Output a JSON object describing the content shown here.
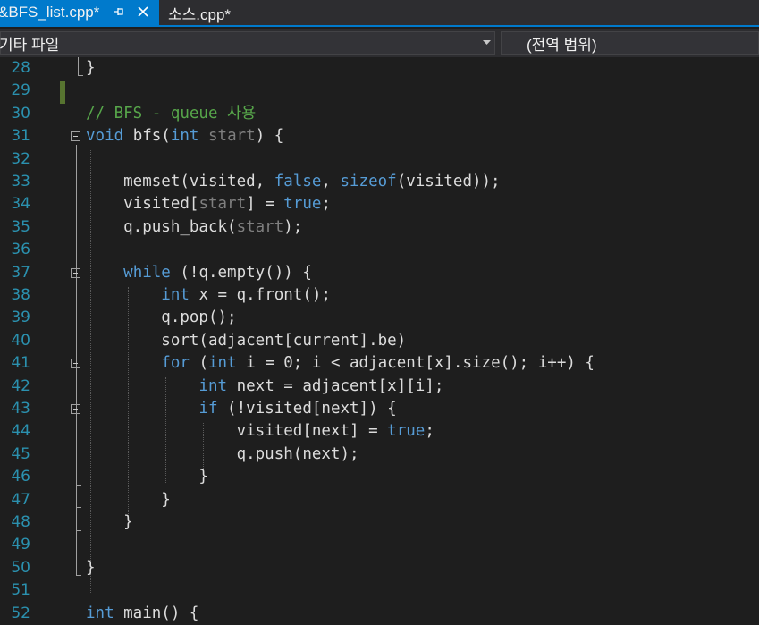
{
  "tabs": [
    {
      "label": "&BFS_list.cpp*",
      "active": true
    },
    {
      "label": "소스.cpp*",
      "active": false
    }
  ],
  "nav": {
    "scope_label": "기타 파일",
    "member_label": "(전역 범위)"
  },
  "colors": {
    "accent": "#007acc",
    "keyword": "#569cd6",
    "comment": "#57a64a",
    "line_number": "#2b91af",
    "text": "#dcdcdc",
    "change_marker": "#577430"
  },
  "lines": [
    {
      "n": "28",
      "tokens": [
        [
          "t",
          "}"
        ]
      ]
    },
    {
      "n": "29",
      "tokens": []
    },
    {
      "n": "30",
      "tokens": [
        [
          "cm",
          "// BFS - queue 사용"
        ]
      ]
    },
    {
      "n": "31",
      "tokens": [
        [
          "kw",
          "void"
        ],
        [
          "t",
          " bfs("
        ],
        [
          "kw",
          "int"
        ],
        [
          "t",
          " "
        ],
        [
          "pm",
          "start"
        ],
        [
          "t",
          ") {"
        ]
      ]
    },
    {
      "n": "32",
      "tokens": []
    },
    {
      "n": "33",
      "tokens": [
        [
          "t",
          "    memset(visited, "
        ],
        [
          "kw",
          "false"
        ],
        [
          "t",
          ", "
        ],
        [
          "kw",
          "sizeof"
        ],
        [
          "t",
          "(visited));"
        ]
      ]
    },
    {
      "n": "34",
      "tokens": [
        [
          "t",
          "    visited["
        ],
        [
          "pm",
          "start"
        ],
        [
          "t",
          "] = "
        ],
        [
          "kw",
          "true"
        ],
        [
          "t",
          ";"
        ]
      ]
    },
    {
      "n": "35",
      "tokens": [
        [
          "t",
          "    q.push_back("
        ],
        [
          "pm",
          "start"
        ],
        [
          "t",
          ");"
        ]
      ]
    },
    {
      "n": "36",
      "tokens": []
    },
    {
      "n": "37",
      "tokens": [
        [
          "t",
          "    "
        ],
        [
          "kw",
          "while"
        ],
        [
          "t",
          " (!q.empty()) {"
        ]
      ]
    },
    {
      "n": "38",
      "tokens": [
        [
          "t",
          "        "
        ],
        [
          "kw",
          "int"
        ],
        [
          "t",
          " x = q.front();"
        ]
      ]
    },
    {
      "n": "39",
      "tokens": [
        [
          "t",
          "        q.pop();"
        ]
      ]
    },
    {
      "n": "40",
      "tokens": [
        [
          "t",
          "        sort(adjacent[current].be)"
        ]
      ]
    },
    {
      "n": "41",
      "tokens": [
        [
          "t",
          "        "
        ],
        [
          "kw",
          "for"
        ],
        [
          "t",
          " ("
        ],
        [
          "kw",
          "int"
        ],
        [
          "t",
          " i = 0; i < adjacent[x].size(); i++) {"
        ]
      ]
    },
    {
      "n": "42",
      "tokens": [
        [
          "t",
          "            "
        ],
        [
          "kw",
          "int"
        ],
        [
          "t",
          " next = adjacent[x][i];"
        ]
      ]
    },
    {
      "n": "43",
      "tokens": [
        [
          "t",
          "            "
        ],
        [
          "kw",
          "if"
        ],
        [
          "t",
          " (!visited[next]) {"
        ]
      ]
    },
    {
      "n": "44",
      "tokens": [
        [
          "t",
          "                visited[next] = "
        ],
        [
          "kw",
          "true"
        ],
        [
          "t",
          ";"
        ]
      ]
    },
    {
      "n": "45",
      "tokens": [
        [
          "t",
          "                q.push(next);"
        ]
      ]
    },
    {
      "n": "46",
      "tokens": [
        [
          "t",
          "            }"
        ]
      ]
    },
    {
      "n": "47",
      "tokens": [
        [
          "t",
          "        }"
        ]
      ]
    },
    {
      "n": "48",
      "tokens": [
        [
          "t",
          "    }"
        ]
      ]
    },
    {
      "n": "49",
      "tokens": []
    },
    {
      "n": "50",
      "tokens": [
        [
          "t",
          "}"
        ]
      ]
    },
    {
      "n": "51",
      "tokens": []
    },
    {
      "n": "52",
      "tokens": [
        [
          "kw",
          "int"
        ],
        [
          "t",
          " main() {"
        ]
      ]
    }
  ]
}
